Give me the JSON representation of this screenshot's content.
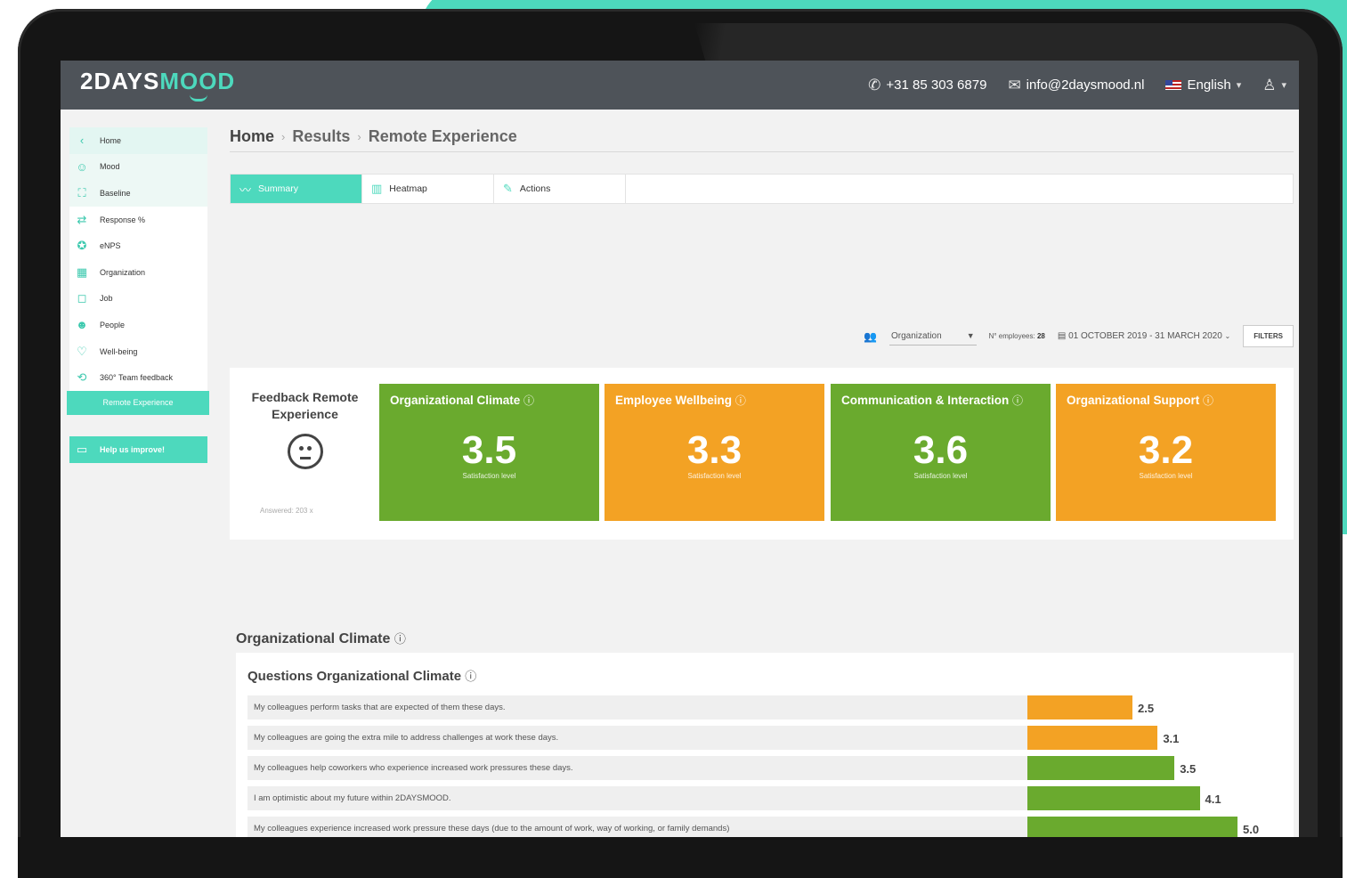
{
  "header": {
    "logo_main": "2DAYS",
    "logo_accent": "MOOD",
    "phone": "+31 85 303 6879",
    "email": "info@2daysmood.nl",
    "language": "English"
  },
  "sidebar": {
    "items": [
      {
        "label": "Home",
        "icon": "chevron-left-icon"
      },
      {
        "label": "Mood",
        "icon": "smiley-icon"
      },
      {
        "label": "Baseline",
        "icon": "expand-icon"
      },
      {
        "label": "Response %",
        "icon": "repeat-icon"
      },
      {
        "label": "eNPS",
        "icon": "star-icon"
      },
      {
        "label": "Organization",
        "icon": "building-icon"
      },
      {
        "label": "Job",
        "icon": "briefcase-icon"
      },
      {
        "label": "People",
        "icon": "face-icon"
      },
      {
        "label": "Well-being",
        "icon": "heart-icon"
      },
      {
        "label": "360° Team feedback",
        "icon": "team-icon"
      }
    ],
    "active_label": "Remote Experience",
    "help_label": "Help us improve!"
  },
  "breadcrumb": [
    "Home",
    "Results",
    "Remote Experience"
  ],
  "tabs": [
    {
      "label": "Summary"
    },
    {
      "label": "Heatmap"
    },
    {
      "label": "Actions"
    }
  ],
  "filters": {
    "organization": "Organization",
    "employees_label": "N° employees:",
    "employees_count": "28",
    "date_range": "01 OCTOBER 2019 - 31 MARCH 2020",
    "filters_button": "FILTERS"
  },
  "summary": {
    "feedback_title": "Feedback Remote Experience",
    "answered": "Answered: 203 x",
    "cards": [
      {
        "title": "Organizational Climate",
        "value": "3.5",
        "label": "Satisfaction level",
        "color": "#6aaa2e"
      },
      {
        "title": "Employee Wellbeing",
        "value": "3.3",
        "label": "Satisfaction level",
        "color": "#f3a224"
      },
      {
        "title": "Communication & Interaction",
        "value": "3.6",
        "label": "Satisfaction level",
        "color": "#6aaa2e"
      },
      {
        "title": "Organizational Support",
        "value": "3.2",
        "label": "Satisfaction level",
        "color": "#f3a224"
      }
    ]
  },
  "section": {
    "title": "Organizational Climate",
    "panel_title": "Questions Organizational Climate"
  },
  "chart_data": {
    "type": "bar",
    "orientation": "horizontal",
    "categories": [
      "My colleagues perform tasks that are expected of them these days.",
      "My colleagues are going the extra mile to address challenges at work these days.",
      "My colleagues help coworkers who experience increased work pressures these days.",
      "I am optimistic about my future within 2DAYSMOOD.",
      "My colleagues experience increased work pressure these days (due to the amount of work, way of working, or family demands)"
    ],
    "values": [
      2.5,
      3.1,
      3.5,
      4.1,
      5.0
    ],
    "value_labels": [
      "2.5",
      "3.1",
      "3.5",
      "4.1",
      "5.0"
    ],
    "colors": [
      "#f3a224",
      "#f3a224",
      "#6aaa2e",
      "#6aaa2e",
      "#6aaa2e"
    ],
    "xlim": [
      0,
      5
    ]
  }
}
